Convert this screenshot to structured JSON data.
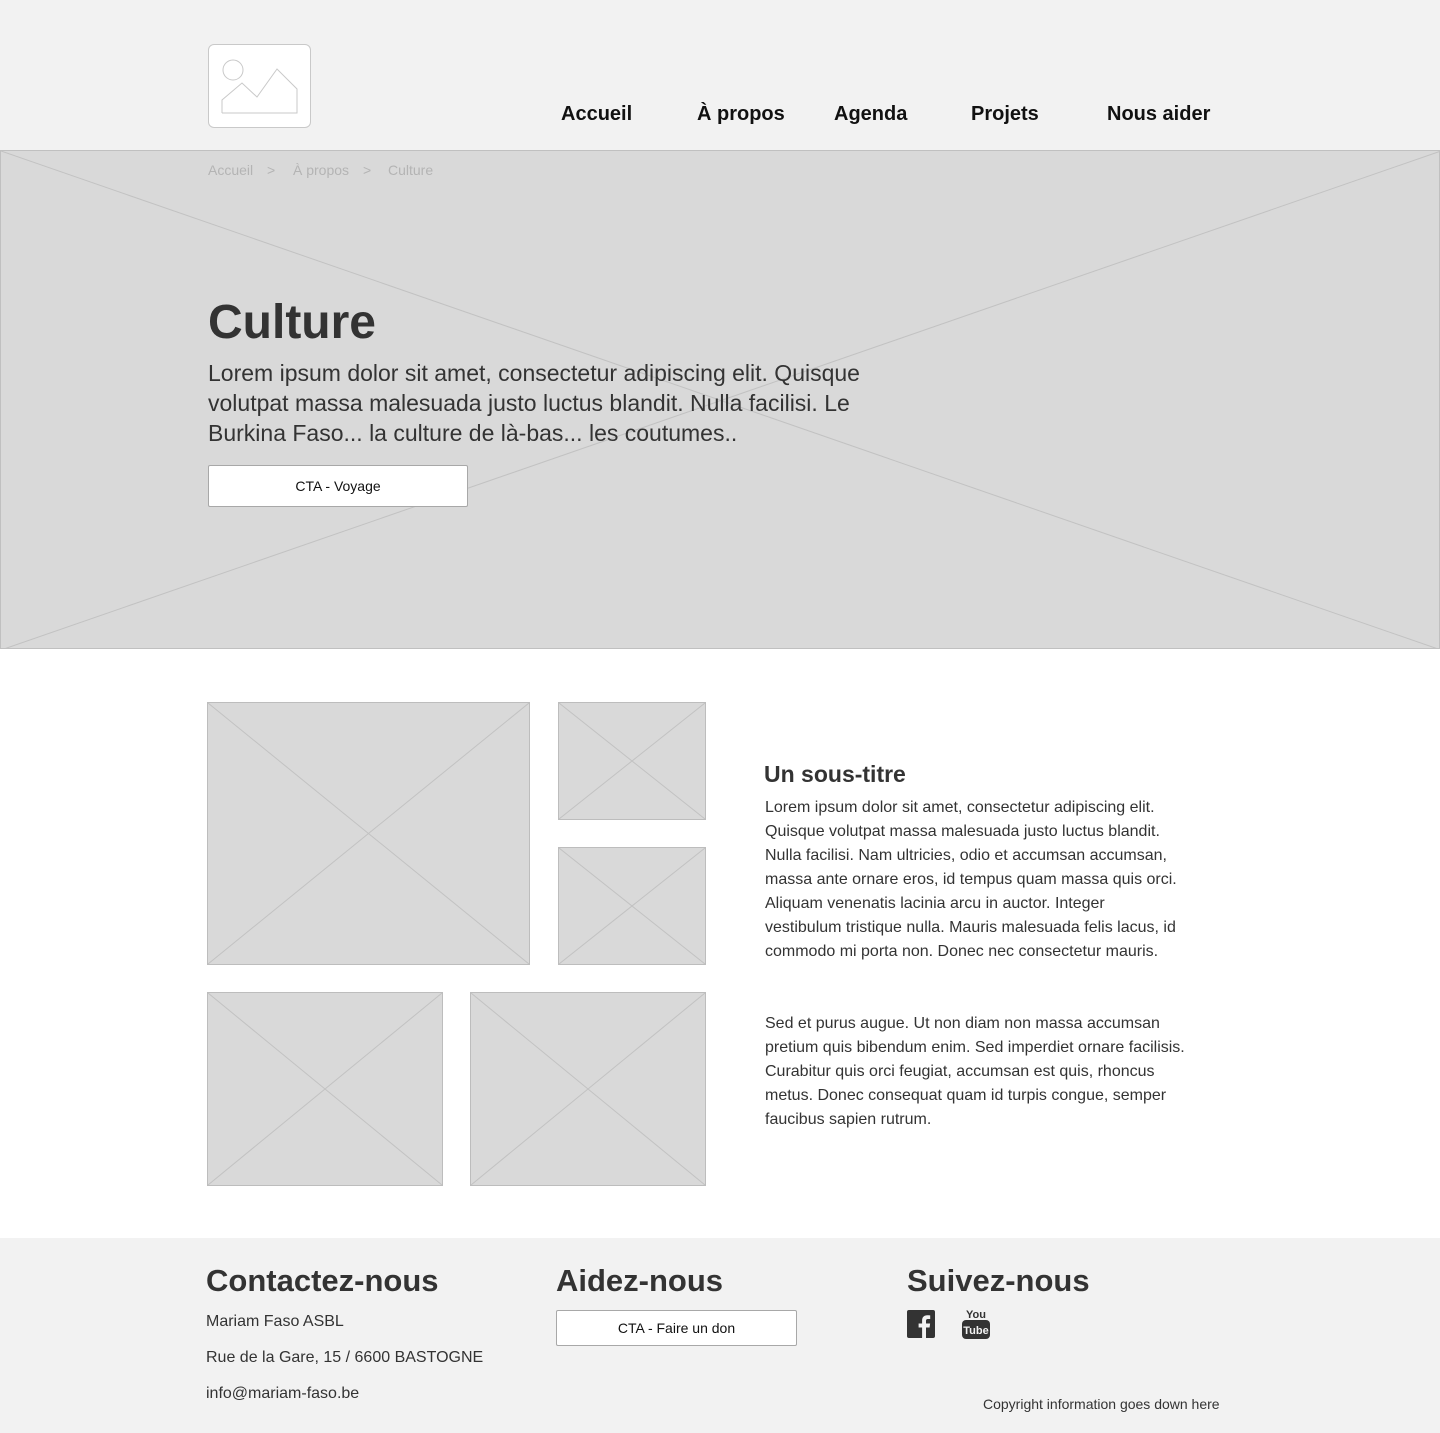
{
  "header": {
    "logo_alt": "image-placeholder-icon",
    "nav": [
      {
        "label": "Accueil"
      },
      {
        "label": "À propos"
      },
      {
        "label": "Agenda"
      },
      {
        "label": "Projets"
      },
      {
        "label": "Nous aider"
      }
    ]
  },
  "hero": {
    "breadcrumb": [
      "Accueil",
      ">",
      "À propos",
      ">",
      "Culture"
    ],
    "title": "Culture",
    "text": "Lorem ipsum dolor sit amet, consectetur adipiscing elit. Quisque volutpat massa malesuada justo luctus blandit. Nulla facilisi. Le Burkina Faso... la culture de là-bas... les coutumes..",
    "cta_label": "CTA - Voyage"
  },
  "content": {
    "subtitle": "Un sous-titre",
    "paragraph_1": "Lorem ipsum dolor sit amet, consectetur adipiscing elit. Quisque volutpat massa malesuada justo luctus blandit. Nulla facilisi. Nam ultricies, odio et accumsan accumsan, massa ante ornare eros, id tempus quam massa quis orci. Aliquam venenatis lacinia arcu in auctor. Integer vestibulum tristique nulla. Mauris malesuada felis lacus, id commodo mi porta non. Donec nec consectetur mauris.",
    "paragraph_2": "Sed et purus augue. Ut non diam non massa accumsan pretium quis bibendum enim. Sed imperdiet ornare facilisis. Curabitur quis orci feugiat, accumsan est quis, rhoncus metus. Donec consequat quam id turpis congue, semper faucibus sapien rutrum."
  },
  "footer": {
    "contact": {
      "heading": "Contactez-nous",
      "name": "Mariam Faso ASBL",
      "address": "Rue de la Gare, 15 / 6600 BASTOGNE",
      "email": "info@mariam-faso.be"
    },
    "help": {
      "heading": "Aidez-nous",
      "cta_label": "CTA - Faire un don"
    },
    "follow": {
      "heading": "Suivez-nous",
      "icons": [
        "facebook-icon",
        "youtube-icon"
      ]
    },
    "copyright": "Copyright information goes down here"
  },
  "colors": {
    "header_bg": "#f2f2f2",
    "placeholder_bg": "#d9d9d9",
    "text": "#333333",
    "breadcrumb": "#b4b4b4"
  }
}
